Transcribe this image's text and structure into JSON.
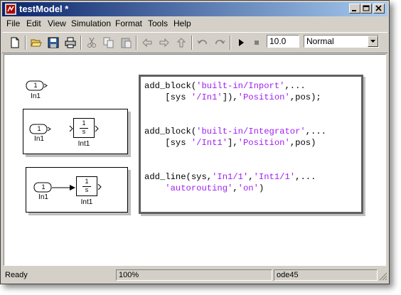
{
  "window": {
    "title": "testModel *"
  },
  "menu": [
    "File",
    "Edit",
    "View",
    "Simulation",
    "Format",
    "Tools",
    "Help"
  ],
  "toolbar": {
    "stop_time": "10.0",
    "sim_mode": "Normal"
  },
  "diagram": {
    "inport_num": "1",
    "in1_label": "In1",
    "int1_label": "Int1",
    "integrator_num": "1",
    "integrator_den": "s"
  },
  "code": {
    "line1_a": "add_block(",
    "line1_b": "'built-in/Inport'",
    "line1_c": ",...",
    "line2_a": "    [sys ",
    "line2_b": "'/In1'",
    "line2_c": "]),",
    "line2_d": "'Position'",
    "line2_e": ",pos);",
    "line3_a": "add_block(",
    "line3_b": "'built-in/Integrator'",
    "line3_c": ",...",
    "line4_a": "    [sys ",
    "line4_b": "'/Int1'",
    "line4_c": "],",
    "line4_d": "'Position'",
    "line4_e": ",pos)",
    "line5_a": "add_line(sys,",
    "line5_b": "'In1/1'",
    "line5_c": ",",
    "line5_d": "'Int1/1'",
    "line5_e": ",...",
    "line6_a": "    ",
    "line6_b": "'autorouting'",
    "line6_c": ",",
    "line6_d": "'on'",
    "line6_e": ")"
  },
  "status": {
    "ready": "Ready",
    "zoom": "100%",
    "solver": "ode45"
  },
  "colors": {
    "string": "#a020f0",
    "titlebar": "#0a246a"
  }
}
